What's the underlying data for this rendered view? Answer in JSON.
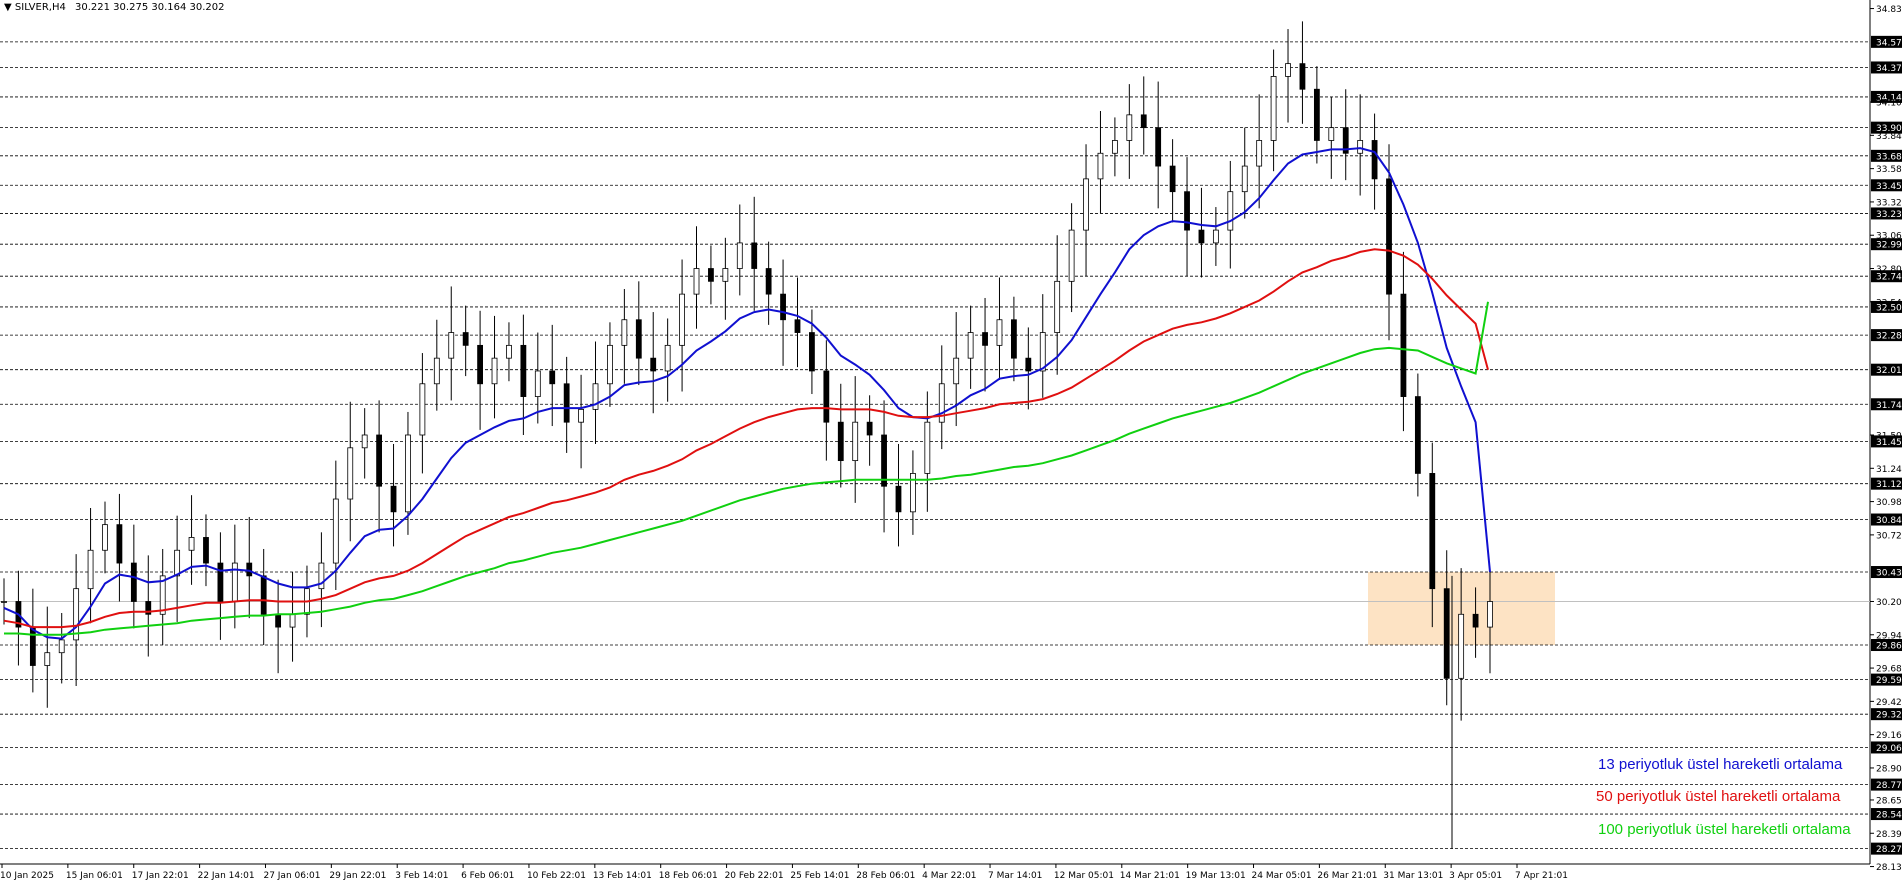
{
  "header": {
    "symbol": "SILVER,H4",
    "ohlc": "30.221 30.275 30.164 30.202"
  },
  "legend": [
    {
      "label": "13 periyotluk üstel hareketli ortalama",
      "color": "#1010d0"
    },
    {
      "label": "50 periyotluk üstel hareketli ortalama",
      "color": "#e01010"
    },
    {
      "label": "100 periyotluk üstel hareketli ortalama",
      "color": "#10d010"
    }
  ],
  "colors": {
    "ema13": "#1010d0",
    "ema50": "#e01010",
    "ema100": "#10d010",
    "candles": "#000000",
    "zone": "#fde3c4",
    "current_line": "#c0c0c0"
  },
  "chart_data": {
    "type": "line",
    "title": "SILVER,H4",
    "ylim": [
      28.15,
      34.85
    ],
    "x": [
      "10 Jan 2025",
      "15 Jan 06:01",
      "17 Jan 22:01",
      "22 Jan 14:01",
      "27 Jan 06:01",
      "29 Jan 22:01",
      "3 Feb 14:01",
      "6 Feb 06:01",
      "10 Feb 22:01",
      "13 Feb 14:01",
      "18 Feb 06:01",
      "20 Feb 22:01",
      "25 Feb 14:01",
      "28 Feb 06:01",
      "4 Mar 22:01",
      "7 Mar 14:01",
      "12 Mar 05:01",
      "14 Mar 21:01",
      "19 Mar 13:01",
      "24 Mar 05:01",
      "26 Mar 21:01",
      "31 Mar 13:01",
      "3 Apr 05:01",
      "7 Apr 21:01"
    ],
    "y_ticks": [
      "34.83",
      "34.57",
      "34.37",
      "34.14",
      "34.10",
      "33.90",
      "33.84",
      "33.68",
      "33.58",
      "33.45",
      "33.32",
      "33.23",
      "33.06",
      "32.99",
      "32.80",
      "32.74",
      "32.54",
      "32.50",
      "32.28",
      "32.01",
      "31.74",
      "31.50",
      "31.45",
      "31.24",
      "31.12",
      "30.98",
      "30.84",
      "30.72",
      "30.43",
      "30.20",
      "29.94",
      "29.86",
      "29.68",
      "29.59",
      "29.42",
      "29.32",
      "29.16",
      "29.06",
      "28.90",
      "28.77",
      "28.65",
      "28.54",
      "28.39",
      "28.27",
      "28.13"
    ],
    "level_lines": [
      "34.57",
      "34.37",
      "34.14",
      "33.90",
      "33.68",
      "33.45",
      "33.23",
      "32.99",
      "32.74",
      "32.50",
      "32.28",
      "32.01",
      "31.74",
      "31.45",
      "31.12",
      "30.84",
      "30.43",
      "29.86",
      "29.59",
      "29.32",
      "29.06",
      "28.77",
      "28.54",
      "28.27"
    ],
    "current_price": "30.20",
    "zone": {
      "x_from": "3 Apr 05:01",
      "x_to": "7 Apr 21:01",
      "y_low": 29.86,
      "y_high": 30.43
    },
    "close": [
      30.2,
      30.0,
      29.7,
      29.8,
      29.9,
      30.3,
      30.6,
      30.8,
      30.5,
      30.2,
      30.1,
      30.4,
      30.6,
      30.7,
      30.5,
      30.2,
      30.5,
      30.4,
      30.1,
      30.0,
      30.1,
      30.3,
      30.5,
      31.0,
      31.4,
      31.5,
      31.1,
      30.9,
      31.5,
      31.9,
      32.1,
      32.3,
      32.2,
      31.9,
      32.1,
      32.2,
      31.8,
      32.0,
      31.9,
      31.6,
      31.7,
      31.9,
      32.2,
      32.4,
      32.1,
      32.0,
      32.2,
      32.6,
      32.8,
      32.7,
      32.8,
      33.0,
      32.8,
      32.6,
      32.4,
      32.3,
      32.0,
      31.6,
      31.3,
      31.6,
      31.5,
      31.1,
      30.9,
      31.2,
      31.6,
      31.9,
      32.1,
      32.3,
      32.2,
      32.4,
      32.1,
      32.0,
      32.3,
      32.7,
      33.1,
      33.5,
      33.7,
      33.8,
      34.0,
      33.9,
      33.6,
      33.4,
      33.1,
      33.0,
      33.1,
      33.4,
      33.6,
      33.8,
      34.3,
      34.4,
      34.2,
      33.8,
      33.9,
      33.7,
      33.8,
      33.5,
      32.6,
      31.8,
      31.2,
      30.3,
      29.6,
      30.1,
      30.0,
      30.2
    ],
    "series": [
      {
        "name": "13 periyotluk üstel hareketli ortalama",
        "values": [
          30.15,
          30.1,
          29.98,
          29.92,
          29.91,
          30.0,
          30.16,
          30.34,
          30.41,
          30.39,
          30.35,
          30.36,
          30.41,
          30.47,
          30.48,
          30.44,
          30.45,
          30.44,
          30.39,
          30.34,
          30.31,
          30.31,
          30.34,
          30.44,
          30.58,
          30.71,
          30.76,
          30.77,
          30.87,
          31.0,
          31.16,
          31.32,
          31.44,
          31.5,
          31.56,
          31.61,
          31.63,
          31.68,
          31.71,
          31.71,
          31.71,
          31.74,
          31.8,
          31.89,
          31.91,
          31.92,
          31.96,
          32.05,
          32.16,
          32.23,
          32.31,
          32.41,
          32.46,
          32.48,
          32.46,
          32.43,
          32.37,
          32.26,
          32.12,
          32.05,
          31.97,
          31.85,
          31.71,
          31.64,
          31.63,
          31.67,
          31.73,
          31.81,
          31.86,
          31.94,
          31.96,
          31.97,
          32.02,
          32.11,
          32.24,
          32.42,
          32.6,
          32.77,
          32.95,
          33.06,
          33.13,
          33.17,
          33.16,
          33.14,
          33.13,
          33.17,
          33.24,
          33.35,
          33.49,
          33.62,
          33.69,
          33.71,
          33.73,
          33.73,
          33.74,
          33.71,
          33.55,
          33.3,
          33.0,
          32.61,
          32.18,
          31.88,
          31.6,
          30.43
        ]
      },
      {
        "name": "50 periyotluk üstel hareketli ortalama",
        "values": [
          30.05,
          30.03,
          30.0,
          30.0,
          30.0,
          30.01,
          30.04,
          30.08,
          30.11,
          30.12,
          30.12,
          30.13,
          30.15,
          30.17,
          30.19,
          30.19,
          30.2,
          30.21,
          30.21,
          30.2,
          30.2,
          30.2,
          30.22,
          30.25,
          30.3,
          30.35,
          30.38,
          30.4,
          30.44,
          30.5,
          30.57,
          30.64,
          30.71,
          30.76,
          30.81,
          30.86,
          30.89,
          30.93,
          30.97,
          30.99,
          31.02,
          31.05,
          31.09,
          31.15,
          31.19,
          31.22,
          31.26,
          31.31,
          31.38,
          31.43,
          31.49,
          31.55,
          31.6,
          31.64,
          31.67,
          31.7,
          31.71,
          31.71,
          31.7,
          31.7,
          31.7,
          31.68,
          31.65,
          31.64,
          31.64,
          31.65,
          31.67,
          31.69,
          31.71,
          31.74,
          31.75,
          31.76,
          31.78,
          31.82,
          31.87,
          31.94,
          32.01,
          32.08,
          32.16,
          32.23,
          32.28,
          32.33,
          32.36,
          32.38,
          32.41,
          32.45,
          32.5,
          32.55,
          32.62,
          32.7,
          32.77,
          32.81,
          32.86,
          32.89,
          32.93,
          32.95,
          32.94,
          32.9,
          32.83,
          32.72,
          32.59,
          32.48,
          32.37,
          32.01
        ]
      },
      {
        "name": "100 periyotluk üstel hareketli ortalama",
        "values": [
          29.95,
          29.95,
          29.94,
          29.94,
          29.94,
          29.95,
          29.96,
          29.98,
          29.99,
          30.0,
          30.01,
          30.02,
          30.03,
          30.05,
          30.06,
          30.07,
          30.08,
          30.09,
          30.09,
          30.1,
          30.1,
          30.11,
          30.12,
          30.14,
          30.16,
          30.19,
          30.21,
          30.22,
          30.25,
          30.28,
          30.32,
          30.36,
          30.4,
          30.43,
          30.46,
          30.5,
          30.52,
          30.55,
          30.58,
          30.6,
          30.62,
          30.65,
          30.68,
          30.71,
          30.74,
          30.77,
          30.8,
          30.83,
          30.87,
          30.91,
          30.95,
          30.99,
          31.02,
          31.05,
          31.08,
          31.1,
          31.12,
          31.13,
          31.14,
          31.15,
          31.15,
          31.15,
          31.15,
          31.15,
          31.15,
          31.16,
          31.18,
          31.19,
          31.21,
          31.23,
          31.25,
          31.26,
          31.28,
          31.31,
          31.34,
          31.38,
          31.42,
          31.46,
          31.51,
          31.55,
          31.59,
          31.63,
          31.66,
          31.69,
          31.72,
          31.75,
          31.79,
          31.83,
          31.88,
          31.93,
          31.98,
          32.02,
          32.06,
          32.1,
          32.14,
          32.17,
          32.18,
          32.17,
          32.16,
          32.11,
          32.06,
          32.02,
          31.98,
          32.54
        ]
      }
    ]
  }
}
